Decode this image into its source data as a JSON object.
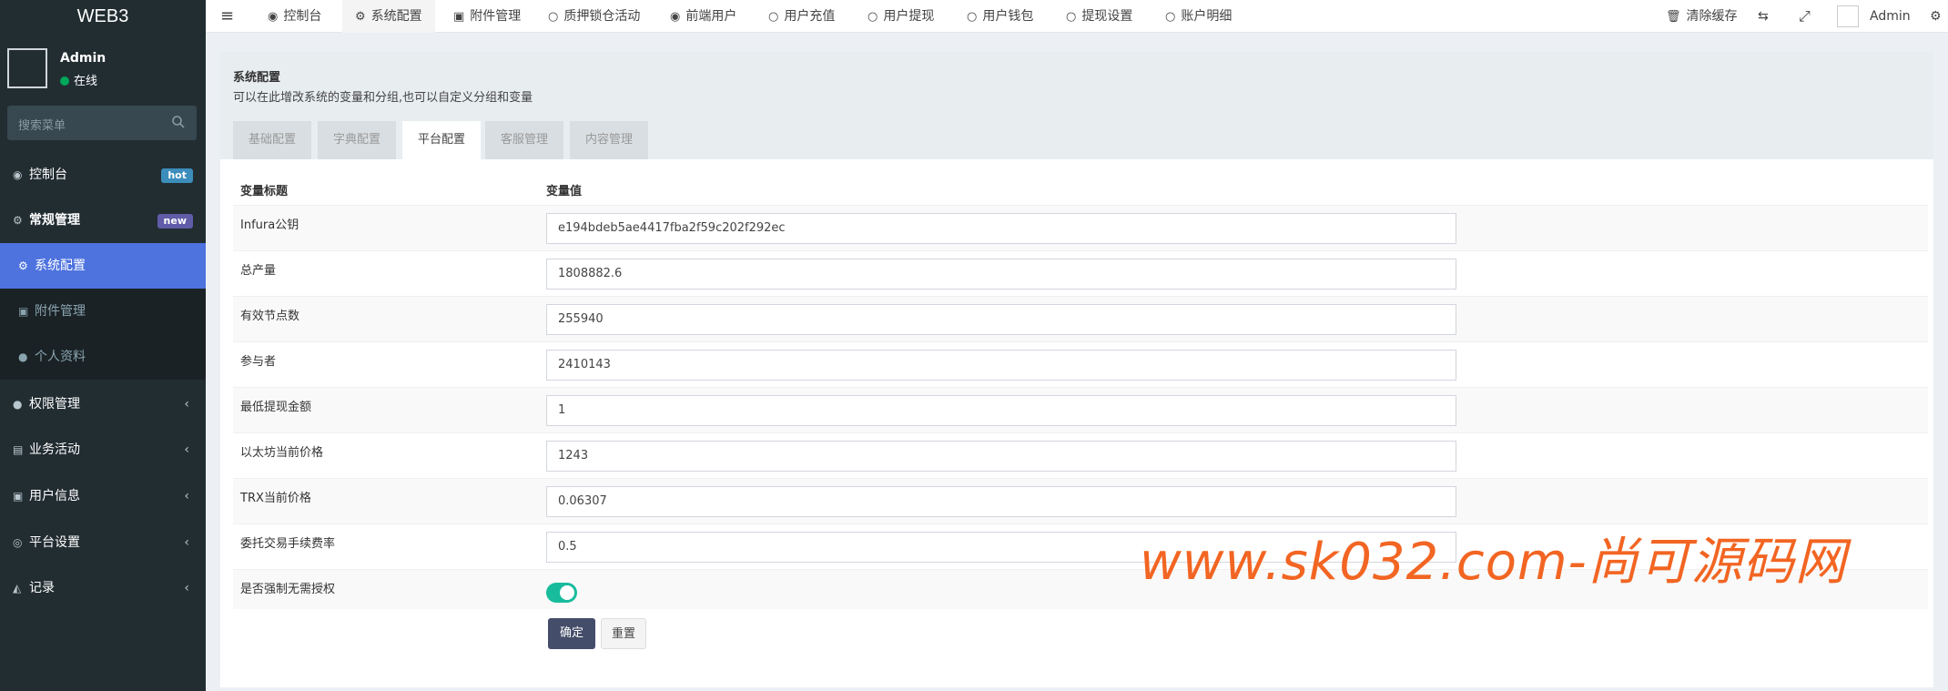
{
  "app": {
    "logo": "WEB3"
  },
  "user": {
    "name": "Admin",
    "status": "在线"
  },
  "search": {
    "placeholder": "搜索菜单"
  },
  "sidebar": {
    "items": [
      {
        "label": "控制台",
        "badge": "hot"
      },
      {
        "label": "常规管理",
        "badge": "new"
      },
      {
        "label": "系统配置"
      },
      {
        "label": "附件管理"
      },
      {
        "label": "个人资料"
      },
      {
        "label": "权限管理"
      },
      {
        "label": "业务活动"
      },
      {
        "label": "用户信息"
      },
      {
        "label": "平台设置"
      },
      {
        "label": "记录"
      }
    ]
  },
  "topbar": {
    "tabs": [
      {
        "label": "控制台"
      },
      {
        "label": "系统配置"
      },
      {
        "label": "附件管理"
      },
      {
        "label": "质押锁仓活动"
      },
      {
        "label": "前端用户"
      },
      {
        "label": "用户充值"
      },
      {
        "label": "用户提现"
      },
      {
        "label": "用户钱包"
      },
      {
        "label": "提现设置"
      },
      {
        "label": "账户明细"
      }
    ],
    "clear_cache": "清除缓存",
    "admin": "Admin"
  },
  "header": {
    "title": "系统配置",
    "subtitle": "可以在此增改系统的变量和分组,也可以自定义分组和变量"
  },
  "config_tabs": [
    {
      "label": "基础配置"
    },
    {
      "label": "字典配置"
    },
    {
      "label": "平台配置"
    },
    {
      "label": "客服管理"
    },
    {
      "label": "内容管理"
    }
  ],
  "table": {
    "col_title": "变量标题",
    "col_value": "变量值",
    "rows": [
      {
        "label": "Infura公钥",
        "value": "e194bdeb5ae4417fba2f59c202f292ec"
      },
      {
        "label": "总产量",
        "value": "1808882.6"
      },
      {
        "label": "有效节点数",
        "value": "255940"
      },
      {
        "label": "参与者",
        "value": "2410143"
      },
      {
        "label": "最低提现金额",
        "value": "1"
      },
      {
        "label": "以太坊当前价格",
        "value": "1243"
      },
      {
        "label": "TRX当前价格",
        "value": "0.06307"
      },
      {
        "label": "委托交易手续费率",
        "value": "0.5"
      },
      {
        "label": "是否强制无需授权",
        "value": "on"
      }
    ]
  },
  "actions": {
    "confirm": "确定",
    "reset": "重置"
  },
  "watermark": "www.sk032.com-尚可源码网",
  "colors": {
    "sidebar_bg": "#222d32",
    "active": "#4e73df",
    "toggle": "#18bc9c",
    "watermark": "#f26522"
  }
}
